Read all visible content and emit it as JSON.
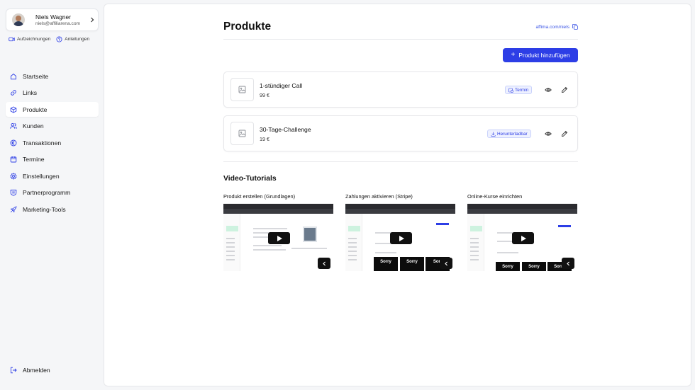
{
  "user": {
    "name": "Niels Wagner",
    "email": "niels@affiliarena.com"
  },
  "quick_links": [
    {
      "label": "Aufzeichnungen",
      "icon": "video-icon"
    },
    {
      "label": "Anleitungen",
      "icon": "help-icon"
    }
  ],
  "nav": [
    {
      "label": "Startseite",
      "icon": "home-icon",
      "active": false
    },
    {
      "label": "Links",
      "icon": "link-icon",
      "active": false
    },
    {
      "label": "Produkte",
      "icon": "box-icon",
      "active": true
    },
    {
      "label": "Kunden",
      "icon": "users-icon",
      "active": false
    },
    {
      "label": "Transaktionen",
      "icon": "euro-icon",
      "active": false
    },
    {
      "label": "Termine",
      "icon": "calendar-icon",
      "active": false
    },
    {
      "label": "Einstellungen",
      "icon": "gear-icon",
      "active": false
    },
    {
      "label": "Partnerprogramm",
      "icon": "badge-icon",
      "active": false
    },
    {
      "label": "Marketing-Tools",
      "icon": "rocket-icon",
      "active": false
    }
  ],
  "logout_label": "Abmelden",
  "page": {
    "title": "Produkte",
    "store_link": "affima.com/niels",
    "add_button": "Produkt hinzufügen"
  },
  "products": [
    {
      "name": "1-stündiger Call",
      "price": "99 €",
      "badge": "Termin",
      "badge_icon": "calendar-clock-icon"
    },
    {
      "name": "30-Tage-Challenge",
      "price": "19 €",
      "badge": "Herunterladbar",
      "badge_icon": "download-icon"
    }
  ],
  "tutorials": {
    "title": "Video-Tutorials",
    "items": [
      {
        "label": "Produkt erstellen (Grundlagen)"
      },
      {
        "label": "Zahlungen aktivieren (Stripe)"
      },
      {
        "label": "Online-Kurse einrichten"
      }
    ]
  },
  "colors": {
    "accent": "#2d3ee6",
    "badge_bg": "#eef1ff",
    "page_bg": "#f5f6f8"
  }
}
